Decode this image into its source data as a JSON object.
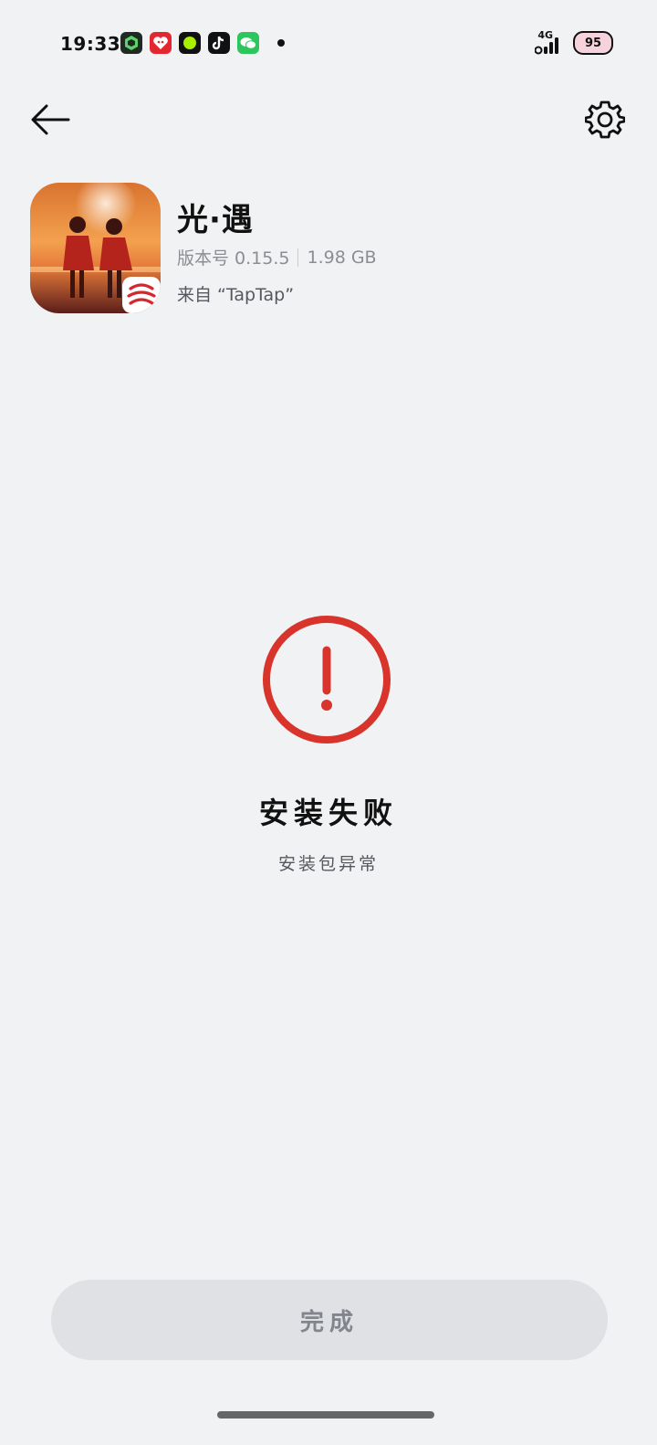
{
  "status_bar": {
    "time": "19:33",
    "network": "4G",
    "battery": "95",
    "notification_icons": [
      "map-app-icon",
      "heart-app-icon",
      "lime-app-icon",
      "tiktok-icon",
      "wechat-icon"
    ]
  },
  "header": {
    "back_icon": "arrow-left-icon",
    "settings_icon": "gear-icon"
  },
  "app": {
    "name": "光·遇",
    "version_label": "版本号 0.15.5",
    "size": "1.98 GB",
    "source": "来自 “TapTap”"
  },
  "result": {
    "title": "安装失败",
    "message": "安装包异常",
    "status_color": "#d9342b"
  },
  "actions": {
    "done_label": "完成"
  }
}
